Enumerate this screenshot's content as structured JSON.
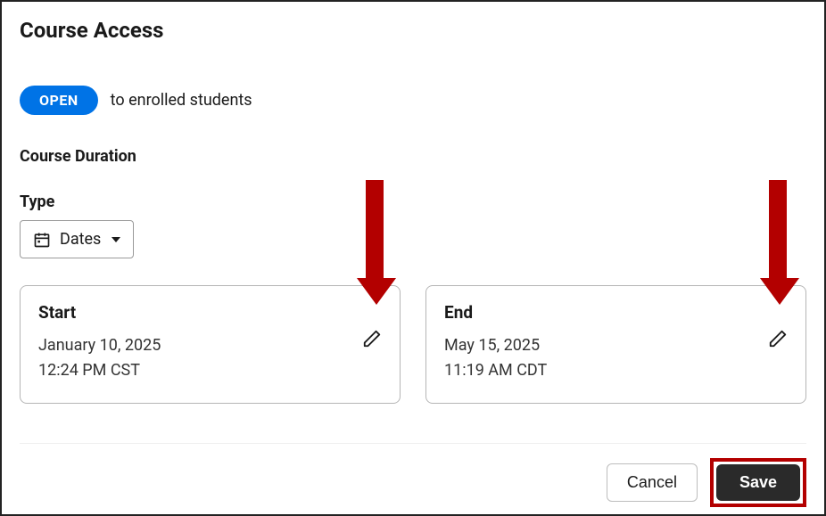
{
  "header": {
    "title": "Course Access"
  },
  "status": {
    "badge": "OPEN",
    "text": "to enrolled students"
  },
  "duration": {
    "section_label": "Course Duration",
    "type_label": "Type",
    "type_value": "Dates"
  },
  "start": {
    "label": "Start",
    "date": "January 10, 2025",
    "time": "12:24 PM CST"
  },
  "end": {
    "label": "End",
    "date": "May 15, 2025",
    "time": "11:19 AM CDT"
  },
  "footer": {
    "cancel": "Cancel",
    "save": "Save"
  }
}
